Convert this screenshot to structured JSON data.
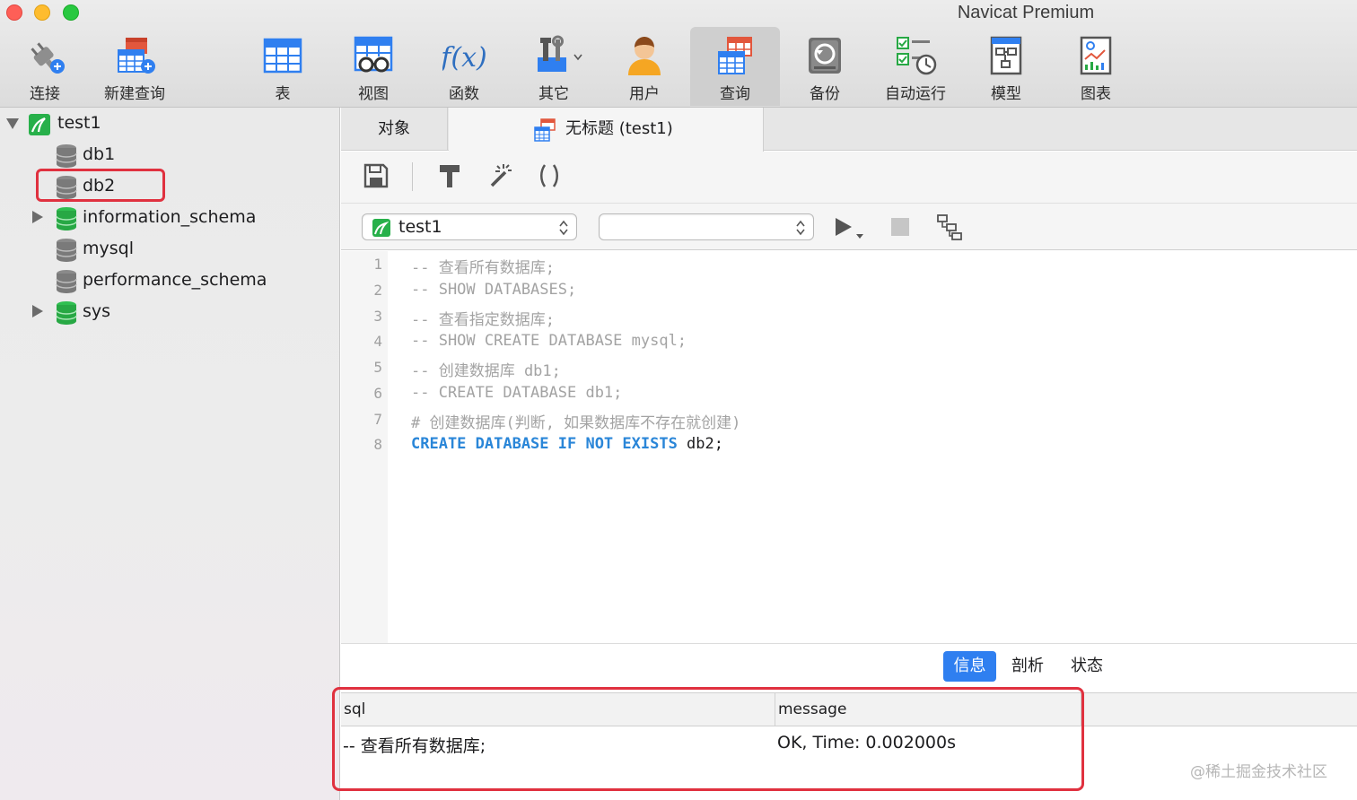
{
  "window": {
    "title": "Navicat Premium"
  },
  "toolbar": {
    "items": [
      {
        "label": "连接",
        "icon": "plug-icon"
      },
      {
        "label": "新建查询",
        "icon": "new-query-icon"
      },
      {
        "label": "表",
        "icon": "table-icon"
      },
      {
        "label": "视图",
        "icon": "view-icon"
      },
      {
        "label": "函数",
        "icon": "function-icon"
      },
      {
        "label": "其它",
        "icon": "tools-icon"
      },
      {
        "label": "用户",
        "icon": "user-icon"
      },
      {
        "label": "查询",
        "icon": "query-icon"
      },
      {
        "label": "备份",
        "icon": "backup-icon"
      },
      {
        "label": "自动运行",
        "icon": "automation-icon"
      },
      {
        "label": "模型",
        "icon": "model-icon"
      },
      {
        "label": "图表",
        "icon": "chart-icon"
      }
    ],
    "active": "查询"
  },
  "sidebar": {
    "connection": {
      "label": "test1",
      "expanded": true
    },
    "databases": [
      {
        "label": "db1",
        "open": false,
        "has_arrow": false
      },
      {
        "label": "db2",
        "open": false,
        "has_arrow": false,
        "highlighted": true
      },
      {
        "label": "information_schema",
        "open": true,
        "has_arrow": true
      },
      {
        "label": "mysql",
        "open": false,
        "has_arrow": false
      },
      {
        "label": "performance_schema",
        "open": false,
        "has_arrow": false
      },
      {
        "label": "sys",
        "open": true,
        "has_arrow": true
      }
    ]
  },
  "tabs": {
    "objects_label": "对象",
    "query_label": "无标题 (test1)"
  },
  "connection_bar": {
    "connection_value": "test1",
    "database_value": ""
  },
  "editor": {
    "lines": [
      {
        "n": "1",
        "text": "-- 查看所有数据库;",
        "kind": "comment"
      },
      {
        "n": "2",
        "text": "-- SHOW DATABASES;",
        "kind": "comment"
      },
      {
        "n": "3",
        "text": "-- 查看指定数据库;",
        "kind": "comment"
      },
      {
        "n": "4",
        "text": "-- SHOW CREATE DATABASE mysql;",
        "kind": "comment"
      },
      {
        "n": "5",
        "text": "-- 创建数据库 db1;",
        "kind": "comment"
      },
      {
        "n": "6",
        "text": "-- CREATE DATABASE db1;",
        "kind": "comment"
      },
      {
        "n": "7",
        "text": "# 创建数据库(判断, 如果数据库不存在就创建)",
        "kind": "comment"
      },
      {
        "n": "8",
        "keyword": "CREATE DATABASE IF NOT EXISTS",
        "rest": " db2;",
        "kind": "code"
      }
    ]
  },
  "results": {
    "tabs": {
      "info": "信息",
      "profile": "剖析",
      "status": "状态"
    },
    "active_tab": "信息",
    "columns": {
      "sql": "sql",
      "message": "message"
    },
    "rows": [
      {
        "sql": "-- 查看所有数据库;",
        "message": "OK, Time: 0.002000s"
      }
    ]
  },
  "watermark": "@稀土掘金技术社区",
  "colors": {
    "accent": "#2f7ff0",
    "highlight_box": "#e0313f",
    "keyword": "#2a86d8",
    "comment": "#a3a3a3",
    "db_green": "#27a844",
    "db_gray": "#7a7a7a"
  }
}
